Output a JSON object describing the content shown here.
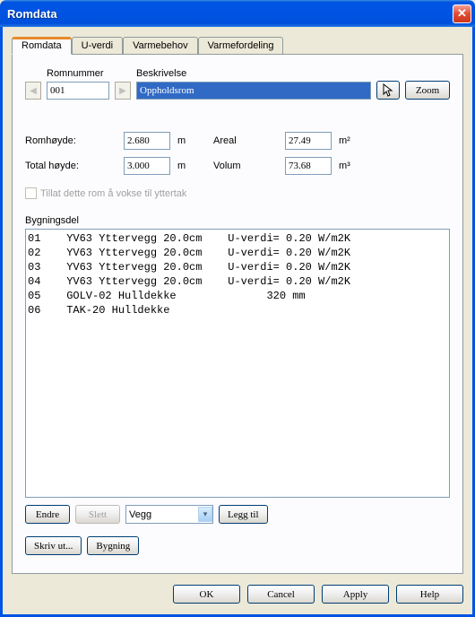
{
  "window": {
    "title": "Romdata"
  },
  "tabs": [
    "Romdata",
    "U-verdi",
    "Varmebehov",
    "Varmefordeling"
  ],
  "active_tab": 0,
  "header": {
    "romnummer_label": "Romnummer",
    "beskrivelse_label": "Beskrivelse",
    "romnummer_value": "001",
    "beskrivelse_value": "Oppholdsrom",
    "zoom_label": "Zoom"
  },
  "measurements": {
    "romhoyde_label": "Romhøyde:",
    "romhoyde_value": "2.680",
    "romhoyde_unit": "m",
    "totalhoyde_label": "Total høyde:",
    "totalhoyde_value": "3.000",
    "totalhoyde_unit": "m",
    "areal_label": "Areal",
    "areal_value": "27.49",
    "areal_unit": "m²",
    "volum_label": "Volum",
    "volum_value": "73.68",
    "volum_unit": "m³"
  },
  "checkbox_label": "Tillat dette rom å vokse til yttertak",
  "list_label": "Bygningsdel",
  "list_rows": [
    "01    YV63 Yttervegg 20.0cm    U-verdi= 0.20 W/m2K",
    "02    YV63 Yttervegg 20.0cm    U-verdi= 0.20 W/m2K",
    "03    YV63 Yttervegg 20.0cm    U-verdi= 0.20 W/m2K",
    "04    YV63 Yttervegg 20.0cm    U-verdi= 0.20 W/m2K",
    "05    GOLV-02 Hulldekke              320 mm",
    "06    TAK-20 Hulldekke"
  ],
  "actions": {
    "endre": "Endre",
    "slett": "Slett",
    "dropdown_value": "Vegg",
    "legg_til": "Legg til",
    "skriv_ut": "Skriv ut...",
    "bygning": "Bygning"
  },
  "footer": {
    "ok": "OK",
    "cancel": "Cancel",
    "apply": "Apply",
    "help": "Help"
  }
}
